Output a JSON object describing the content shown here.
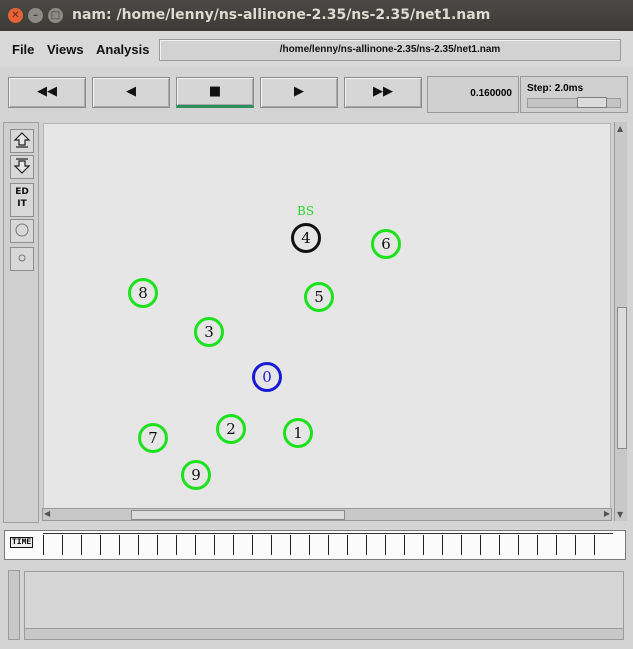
{
  "window": {
    "title": "nam: /home/lenny/ns-allinone-2.35/ns-2.35/net1.nam",
    "close_glyph": "✕",
    "min_glyph": "–",
    "max_glyph": "□"
  },
  "menu": {
    "file": "File",
    "views": "Views",
    "analysis": "Analysis"
  },
  "filepath": "/home/lenny/ns-allinone-2.35/ns-2.35/net1.nam",
  "transport": {
    "rewind": "◀◀",
    "back": "◀",
    "stop": "■",
    "play": "▶",
    "fastforward": "▶▶"
  },
  "time": "0.160000",
  "step": "Step: 2.0ms",
  "tools": {
    "edit": "ED\nIT"
  },
  "timeline_label": "TIME",
  "node_label": "BS",
  "nodes": [
    {
      "id": "0",
      "color": "#1a1ad6"
    },
    {
      "id": "1",
      "color": "#1ce21c"
    },
    {
      "id": "2",
      "color": "#1ce21c"
    },
    {
      "id": "3",
      "color": "#1ce21c"
    },
    {
      "id": "4",
      "color": "#111111"
    },
    {
      "id": "5",
      "color": "#1ce21c"
    },
    {
      "id": "6",
      "color": "#1ce21c"
    },
    {
      "id": "7",
      "color": "#1ce21c"
    },
    {
      "id": "8",
      "color": "#1ce21c"
    },
    {
      "id": "9",
      "color": "#1ce21c"
    }
  ]
}
